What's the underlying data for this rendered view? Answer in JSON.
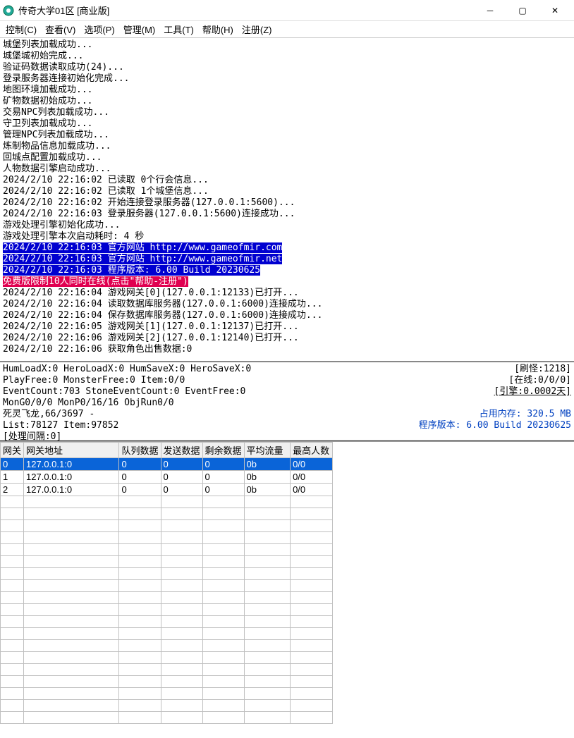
{
  "titlebar": {
    "title": "传奇大学01区 [商业版]"
  },
  "menu": {
    "control": "控制(C)",
    "view": "查看(V)",
    "options": "选项(P)",
    "manage": "管理(M)",
    "tools": "工具(T)",
    "help": "帮助(H)",
    "register": "注册(Z)"
  },
  "console_lines": [
    "城堡列表加载成功...",
    "城堡城初始完成...",
    "验证码数据读取成功(24)...",
    "登录服务器连接初始化完成...",
    "地图环境加载成功...",
    "矿物数据初始成功...",
    "交易NPC列表加载成功...",
    "守卫列表加载成功...",
    "管理NPC列表加载成功...",
    "炼制物品信息加载成功...",
    "回城点配置加载成功...",
    "人物数据引擎启动成功...",
    "2024/2/10 22:16:02 已读取 0个行会信息...",
    "2024/2/10 22:16:02 已读取 1个城堡信息...",
    "2024/2/10 22:16:02 开始连接登录服务器(127.0.0.1:5600)...",
    "2024/2/10 22:16:03 登录服务器(127.0.0.1:5600)连接成功...",
    "游戏处理引擎初始化成功...",
    "游戏处理引擎本次启动耗时: 4 秒"
  ],
  "console_hl_blue": [
    "2024/2/10 22:16:03 官方网站 http://www.gameofmir.com",
    "2024/2/10 22:16:03 官方网站 http://www.gameofmir.net",
    "2024/2/10 22:16:03 程序版本: 6.00 Build 20230625"
  ],
  "console_hl_red": "免费版限制10人同时在线(点击\"帮助-注册\")",
  "console_lines2": [
    "2024/2/10 22:16:04 游戏网关[0](127.0.0.1:12133)已打开...",
    "2024/2/10 22:16:04 读取数据库服务器(127.0.0.1:6000)连接成功...",
    "2024/2/10 22:16:04 保存数据库服务器(127.0.0.1:6000)连接成功...",
    "2024/2/10 22:16:05 游戏网关[1](127.0.0.1:12137)已打开...",
    "2024/2/10 22:16:06 游戏网关[2](127.0.0.1:12140)已打开...",
    "2024/2/10 22:16:06 获取角色出售数据:0"
  ],
  "status": {
    "l1": "HumLoadX:0 HeroLoadX:0 HumSaveX:0 HeroSaveX:0",
    "r1": "[刷怪:1218]",
    "l2": "PlayFree:0 MonsterFree:0 Item:0/0",
    "r2": "[在线:0/0/0]",
    "l3": "EventCount:703 StoneEventCount:0 EventFree:0",
    "r3": "[引擎:0.0002天]",
    "l4": "MonG0/0/0 MonP0/16/16 ObjRun0/0",
    "l5": "死灵飞龙,66/3697 -",
    "r5": "占用内存: 320.5 MB",
    "l6": "List:78127 Item:97852",
    "r6": "程序版本: 6.00 Build 20230625",
    "l7": "[处理间隔:0]"
  },
  "table": {
    "headers": [
      "网关",
      "网关地址",
      "队列数据",
      "发送数据",
      "剩余数据",
      "平均流量",
      "最高人数"
    ],
    "rows": [
      [
        "0",
        "127.0.0.1:0",
        "0",
        "0",
        "0",
        "0b",
        "0/0"
      ],
      [
        "1",
        "127.0.0.1:0",
        "0",
        "0",
        "0",
        "0b",
        "0/0"
      ],
      [
        "2",
        "127.0.0.1:0",
        "0",
        "0",
        "0",
        "0b",
        "0/0"
      ]
    ]
  }
}
